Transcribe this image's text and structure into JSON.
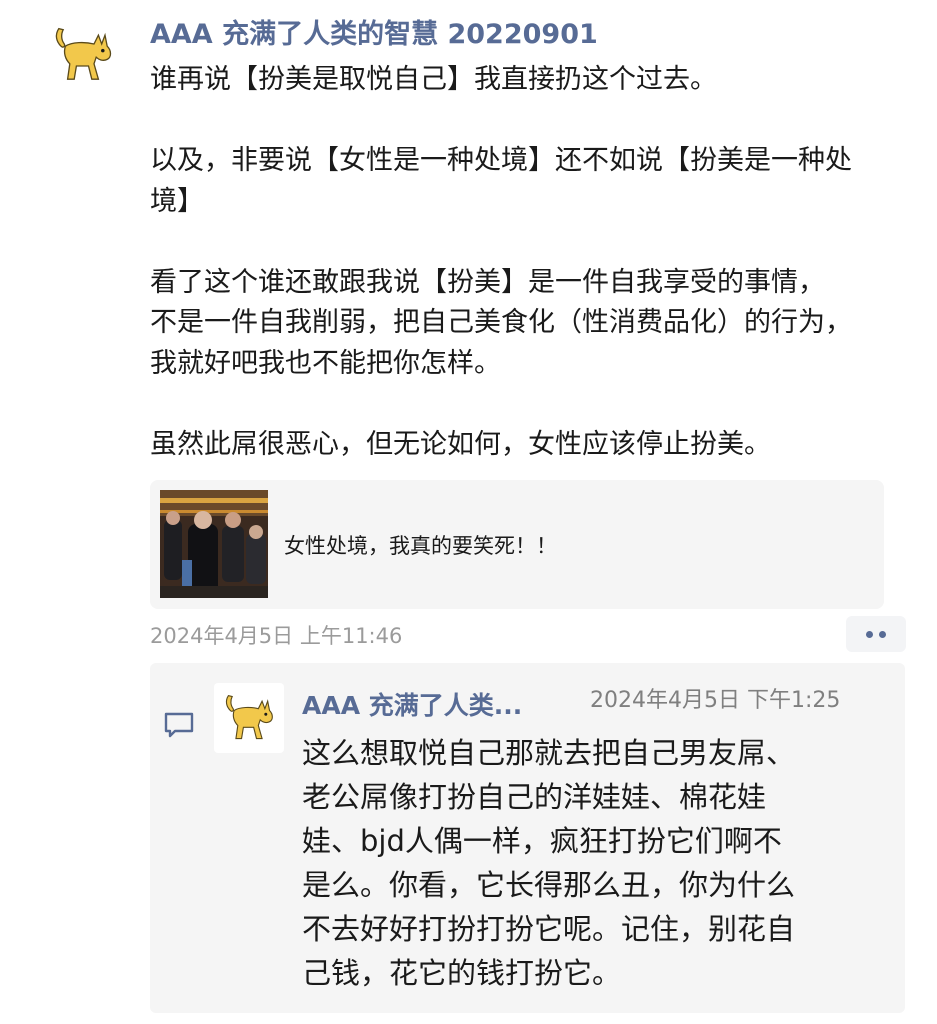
{
  "post": {
    "author": "AAA 充满了人类的智慧 20220901",
    "avatar_icon": "yellow-cat-icon",
    "lines": [
      "谁再说【扮美是取悦自己】我直接扔这个过去。",
      "",
      "以及，非要说【女性是一种处境】还不如说【扮美是一种处",
      "境】",
      "",
      "看了这个谁还敢跟我说【扮美】是一件自我享受的事情，",
      "不是一件自我削弱，把自己美食化（性消费品化）的行为，",
      "我就好吧我也不能把你怎样。",
      "",
      "虽然此屌很恶心，但无论如何，女性应该停止扮美。"
    ],
    "share": {
      "text": "女性处境，我真的要笑死！！"
    },
    "timestamp": "2024年4月5日 上午11:46",
    "more_icon": "more-dots-icon"
  },
  "comment": {
    "icon": "comment-bubble-icon",
    "author": "AAA 充满了人类...",
    "timestamp": "2024年4月5日 下午1:25",
    "lines": [
      "这么想取悦自己那就去把自己男友屌、",
      "老公屌像打扮自己的洋娃娃、棉花娃",
      "娃、bjd人偶一样，疯狂打扮它们啊不",
      "是么。你看，它长得那么丑，你为什么",
      "不去好好打扮打扮它呢。记住，别花自",
      "己钱，花它的钱打扮它。"
    ]
  },
  "colors": {
    "name_blue": "#576b95",
    "cat_yellow": "#f2c84b",
    "card_bg": "#f5f5f5",
    "time_gray": "#9b9b9b"
  }
}
